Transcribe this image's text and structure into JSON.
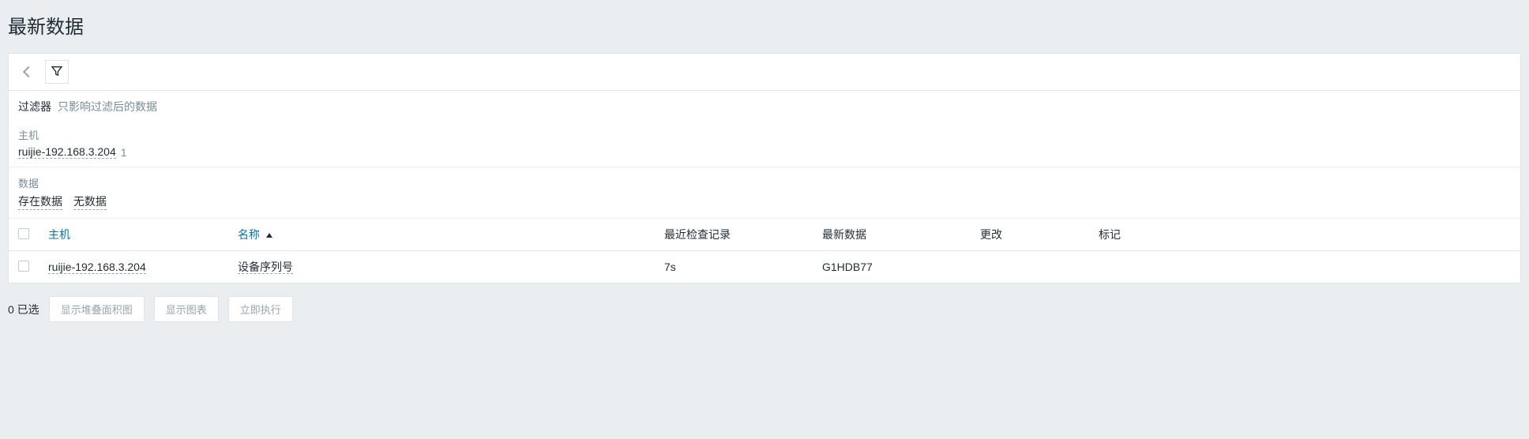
{
  "page": {
    "title": "最新数据"
  },
  "filter": {
    "title": "过滤器",
    "subtitle": "只影响过滤后的数据",
    "groups": {
      "host": {
        "label": "主机",
        "chip_value": "ruijie-192.168.3.204",
        "chip_count": "1"
      },
      "data": {
        "label": "数据",
        "chip_exists": "存在数据",
        "chip_none": "无数据"
      }
    }
  },
  "table": {
    "headers": {
      "host": "主机",
      "name": "名称",
      "last_check": "最近检查记录",
      "last_data": "最新数据",
      "change": "更改",
      "tag": "标记"
    },
    "rows": [
      {
        "host": "ruijie-192.168.3.204",
        "name": "设备序列号",
        "last_check": "7s",
        "last_data": "G1HDB77",
        "change": "",
        "tag": ""
      }
    ]
  },
  "footer": {
    "selected_count_label": "0 已选",
    "stacked_area_btn": "显示堆叠面积图",
    "graph_btn": "显示图表",
    "exec_btn": "立即执行"
  }
}
